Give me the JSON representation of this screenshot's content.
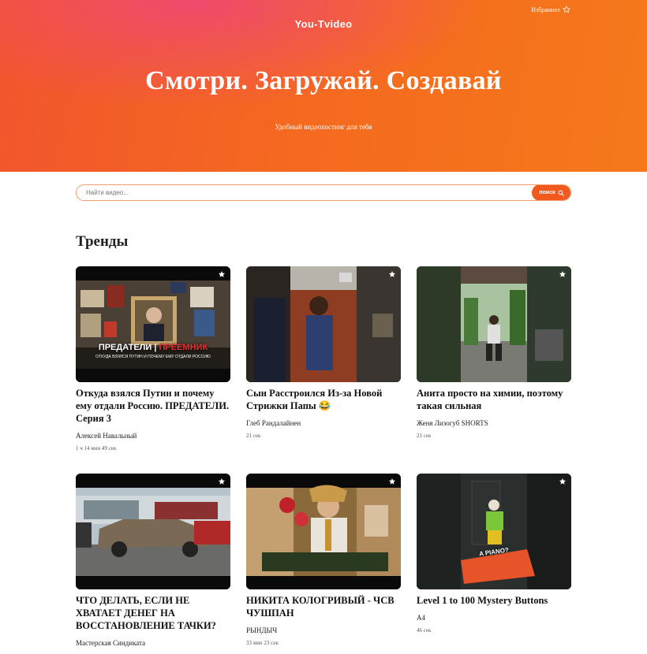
{
  "header": {
    "logo": "You-Tvideo",
    "favorites_label": "Избранное",
    "headline": "Смотри. Загружай. Создавай",
    "tagline": "Удобный видеохостинг для тебя"
  },
  "search": {
    "placeholder": "Найти видео...",
    "button_label": "поиск"
  },
  "section": {
    "title": "Тренды"
  },
  "videos": [
    {
      "title": "Откуда взялся Путин и почему ему отдали Россию. ПРЕДАТЕЛИ. Серия 3",
      "author": "Алексей Навальный",
      "duration": "1 ч 14 мин 49 сек",
      "thumb_text": "ПРЕДАТЕЛИ",
      "thumb_text_red": "ПРЕЕМНИК",
      "thumb_sub": "ОТКУДА ВЗЯЛСЯ ПУТИН И ПОЧЕМУ ЕМУ ОТДАЛИ РОССИЮ"
    },
    {
      "title": "Сын Расстроился Из-за Новой Стрижки Папы 😂",
      "author": "Глеб Рандалайнен",
      "duration": "21 сек"
    },
    {
      "title": "Анита просто на химии, поэтому такая сильная",
      "author": "Женя Лизогуб SHORTS",
      "duration": "21 сек"
    },
    {
      "title": "ЧТО ДЕЛАТЬ, ЕСЛИ НЕ ХВАТАЕТ ДЕНЕГ НА ВОССТАНОВЛЕНИЕ ТАЧКИ?",
      "author": "Мастерская Синдиката",
      "duration": ""
    },
    {
      "title": "НИКИТА КОЛОГРИВЫЙ - ЧСВ ЧУШПАН",
      "author": "РЫНДЫЧ",
      "duration": "33 мин 23 сек"
    },
    {
      "title": "Level 1 to 100 Mystery Buttons",
      "author": "A4",
      "duration": "46 сек",
      "thumb_text": "A PIANO?"
    }
  ],
  "colors": {
    "accent": "#f2591f",
    "hero_start": "#f2552e",
    "hero_end": "#f5791b",
    "search_border": "#f0a06c"
  },
  "icons": {
    "favorites": "star-outline-icon",
    "search": "search-icon",
    "card_favorite": "star-icon"
  }
}
